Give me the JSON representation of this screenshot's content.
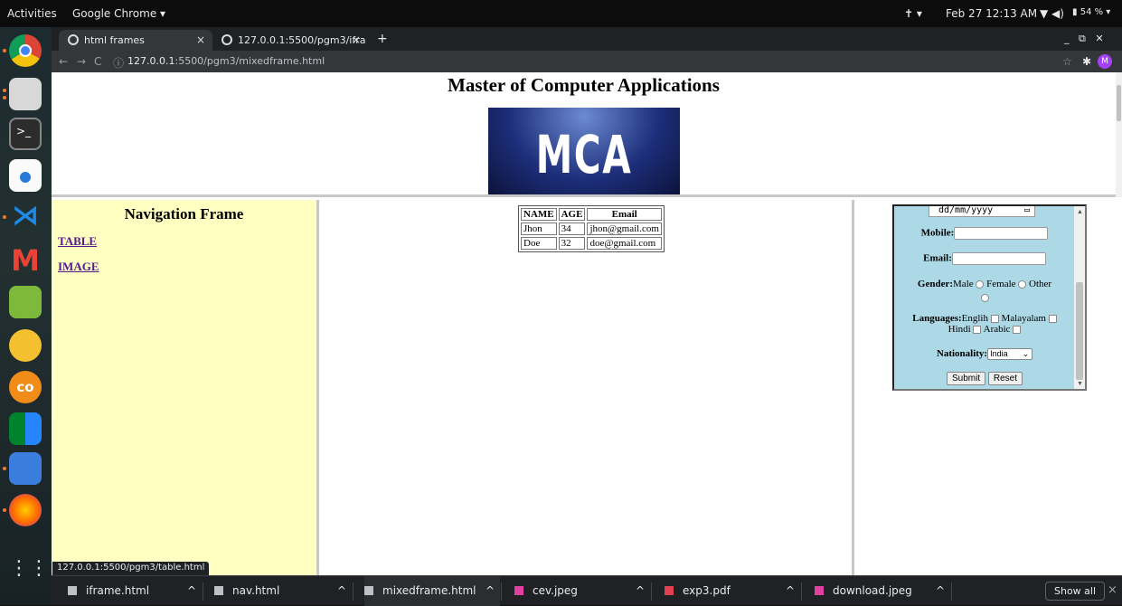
{
  "system_bar": {
    "activities": "Activities",
    "app_menu": "Google Chrome ▾",
    "clock": "Feb 27  12:13 AM",
    "battery": "54 %"
  },
  "dock": {
    "apps": [
      "chrome-icon",
      "files-icon",
      "terminal-icon",
      "software-store-icon",
      "vscode-icon",
      "gmail-icon",
      "text-editor-icon",
      "teapot-app-icon",
      "colab-icon",
      "meet-icon",
      "document-viewer-icon",
      "firefox-icon",
      "show-apps-icon"
    ]
  },
  "browser": {
    "tabs": [
      {
        "title": "html frames",
        "close": "×"
      },
      {
        "title": "127.0.0.1:5500/pgm3/ifra",
        "close": "×"
      }
    ],
    "new_tab": "+",
    "url_host": "127.0.0.1",
    "url_path": ":5500/pgm3/mixedframe.html",
    "profile_initial": "M"
  },
  "top_frame": {
    "title": "Master of Computer Applications",
    "banner_text": "MCA"
  },
  "nav_frame": {
    "title": "Navigation Frame",
    "links": [
      "TABLE",
      "IMAGE"
    ]
  },
  "table": {
    "headers": [
      "NAME",
      "AGE",
      "Email"
    ],
    "rows": [
      [
        "Jhon",
        "34",
        "jhon@gmail.com"
      ],
      [
        "Doe",
        "32",
        "doe@gmail.com"
      ]
    ]
  },
  "form": {
    "date_placeholder": "dd/mm/yyyy",
    "mobile_label": "Mobile:",
    "email_label": "Email:",
    "gender_label": "Gender:",
    "gender_options": [
      "Male",
      "Female",
      "Other"
    ],
    "languages_label": "Languages:",
    "language_options": [
      "Englih",
      "Malayalam",
      "Hindi",
      "Arabic"
    ],
    "nationality_label": "Nationality:",
    "nationality_value": "India",
    "submit": "Submit",
    "reset": "Reset"
  },
  "status_url": "127.0.0.1:5500/pgm3/table.html",
  "downloads": {
    "items": [
      {
        "name": "iframe.html",
        "color": "#bdc1c6"
      },
      {
        "name": "nav.html",
        "color": "#bdc1c6"
      },
      {
        "name": "mixedframe.html",
        "color": "#bdc1c6"
      },
      {
        "name": "cev.jpeg",
        "color": "#e040a0"
      },
      {
        "name": "exp3.pdf",
        "color": "#e04050"
      },
      {
        "name": "download.jpeg",
        "color": "#e040a0"
      }
    ],
    "show_all": "Show all",
    "close": "×"
  }
}
